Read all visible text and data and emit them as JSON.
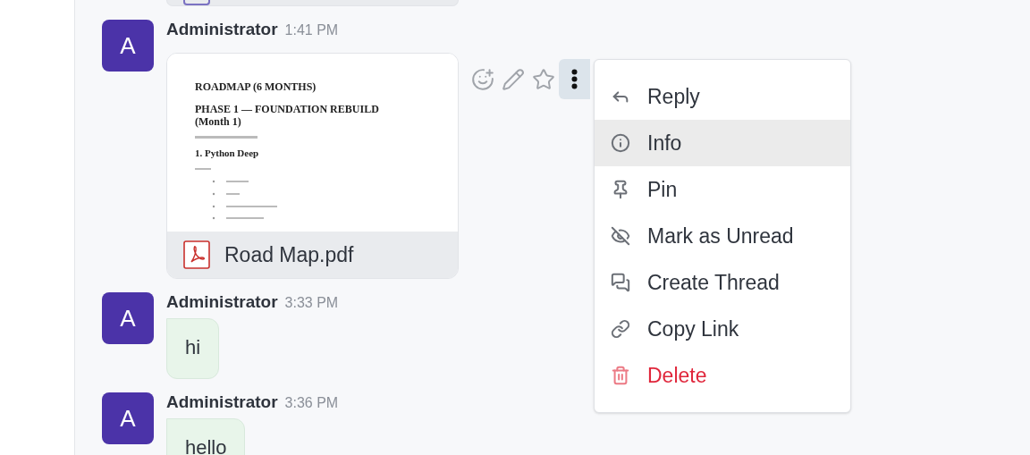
{
  "messages": [
    {
      "avatar": "A",
      "author": "Administrator",
      "time": "1:41 PM",
      "kind": "file",
      "file": {
        "name": "Road Map.pdf",
        "preview": {
          "title": "ROADMAP (6 MONTHS)",
          "heading": "PHASE 1 — FOUNDATION REBUILD (Month 1)",
          "section": "1. Python Deep"
        }
      }
    },
    {
      "avatar": "A",
      "author": "Administrator",
      "time": "3:33 PM",
      "kind": "text",
      "text": "hi"
    },
    {
      "avatar": "A",
      "author": "Administrator",
      "time": "3:36 PM",
      "kind": "text",
      "text": "hello"
    }
  ],
  "message_actions": [
    {
      "kind": "emoji",
      "selected": false
    },
    {
      "kind": "edit",
      "selected": false
    },
    {
      "kind": "star",
      "selected": false
    },
    {
      "kind": "more",
      "selected": true
    }
  ],
  "context_menu": [
    {
      "kind": "reply",
      "label": "Reply",
      "danger": false,
      "selected": false
    },
    {
      "kind": "info",
      "label": "Info",
      "danger": false,
      "selected": true
    },
    {
      "kind": "pin",
      "label": "Pin",
      "danger": false,
      "selected": false
    },
    {
      "kind": "unread",
      "label": "Mark as Unread",
      "danger": false,
      "selected": false
    },
    {
      "kind": "thread",
      "label": "Create Thread",
      "danger": false,
      "selected": false
    },
    {
      "kind": "link",
      "label": "Copy Link",
      "danger": false,
      "selected": false
    },
    {
      "kind": "delete",
      "label": "Delete",
      "danger": true,
      "selected": false
    }
  ]
}
